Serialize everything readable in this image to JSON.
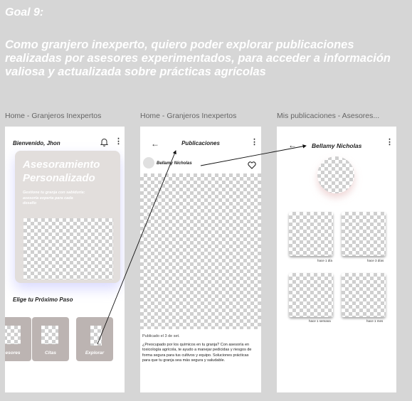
{
  "goal": {
    "title": "Goal 9:",
    "story": "Como granjero inexperto, quiero poder explorar publicaciones realizadas por asesores experimentados, para acceder a información valiosa y actualizada sobre prácticas agrícolas"
  },
  "frames": [
    {
      "label": "Home - Granjeros Inexpertos",
      "greeting": "Bienvenido, Jhon",
      "card_title": "Asesoramiento Personalizado",
      "card_text": "Gestione tu granja con sabiduría: asesoría experta para cada desafío",
      "section_title": "Elige tu Próximo Paso",
      "categories": [
        "esores",
        "Citas",
        "Explorar"
      ],
      "icons": {
        "notification": "bell-icon",
        "menu": "more-vertical-icon"
      }
    },
    {
      "label": "Home - Granjeros Inexpertos",
      "header_title": "Publicaciones",
      "author": "Bellamy Nicholas",
      "date": "Publicado el 3 de set.",
      "body": "¿Preocupado por los químicos en tu granja? Con asesoría en toxicología agrícola, te ayudo a manejar pedicidas y riesgos de forma segura para tus cultivos y equipo. Soluciones prácticas para que tu granja sea más segura y saludable.",
      "icons": {
        "back": "arrow-left-icon",
        "like": "heart-icon",
        "menu": "more-vertical-icon"
      }
    },
    {
      "label": "Mis publicaciones - Asesores...",
      "header_title": "Bellamy Nicholas",
      "posts": [
        {
          "time": "hace 1 día"
        },
        {
          "time": "hace 3 días"
        },
        {
          "time": "hace 1 semana"
        },
        {
          "time": "hace 1 mes"
        }
      ],
      "icons": {
        "back": "arrow-left-icon",
        "menu": "more-vertical-icon"
      }
    }
  ],
  "colors": {
    "background": "#d6d6d6",
    "card": "#e2dedc",
    "category": "#bcb4b2",
    "arrow": "#111111"
  }
}
